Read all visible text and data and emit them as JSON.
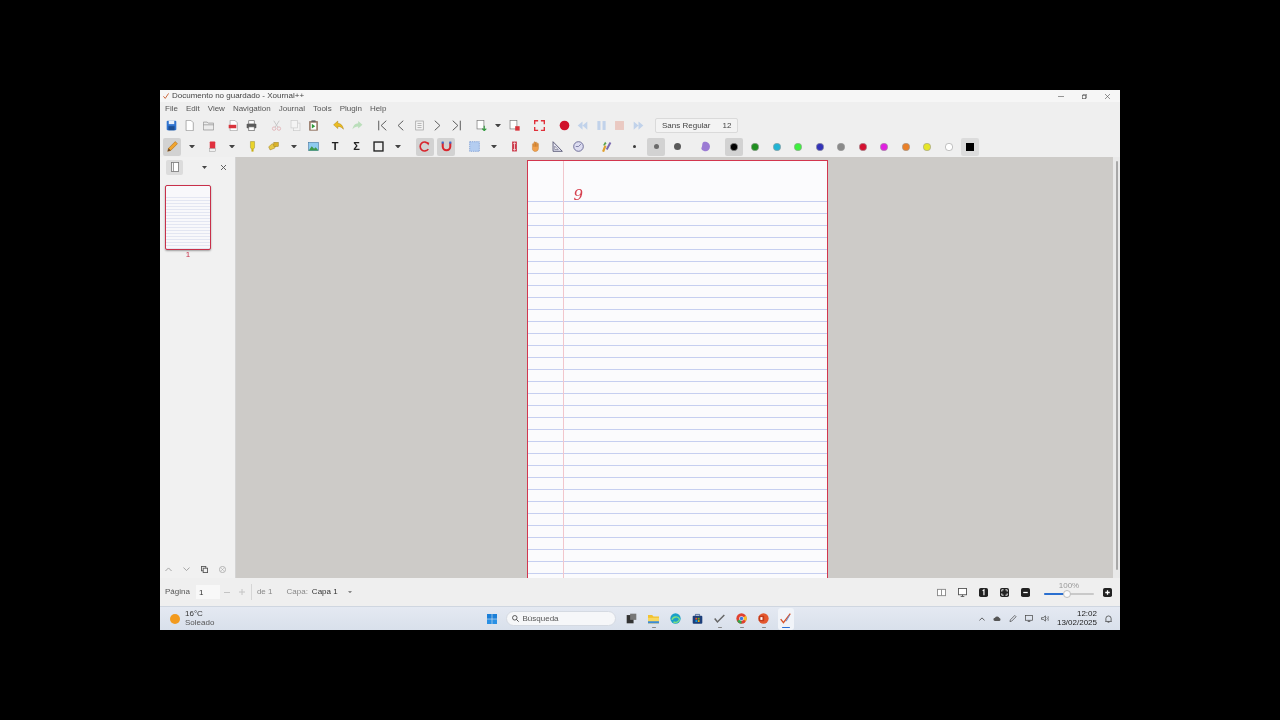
{
  "window": {
    "title": "Documento no guardado - Xournal++"
  },
  "menu": [
    "File",
    "Edit",
    "View",
    "Navigation",
    "Journal",
    "Tools",
    "Plugin",
    "Help"
  ],
  "main_toolbar": {
    "groups": [
      [
        {
          "kind": "save",
          "disabled": false,
          "menu": false
        },
        {
          "kind": "new",
          "disabled": false,
          "menu": false
        },
        {
          "kind": "open",
          "disabled": false,
          "menu": false
        }
      ],
      [
        {
          "kind": "export-pdf",
          "disabled": false,
          "menu": false
        },
        {
          "kind": "print",
          "disabled": false,
          "menu": false
        }
      ],
      [
        {
          "kind": "cut",
          "disabled": true,
          "menu": false
        },
        {
          "kind": "copy",
          "disabled": true,
          "menu": false
        },
        {
          "kind": "paste",
          "disabled": false,
          "menu": false
        }
      ],
      [
        {
          "kind": "undo",
          "disabled": false,
          "menu": false
        },
        {
          "kind": "redo",
          "disabled": true,
          "menu": false
        }
      ],
      [
        {
          "kind": "first-page",
          "disabled": false,
          "menu": false
        },
        {
          "kind": "previous-page",
          "disabled": false,
          "menu": false
        },
        {
          "kind": "go-to-page",
          "disabled": false,
          "menu": false
        },
        {
          "kind": "next-page",
          "disabled": false,
          "menu": false
        },
        {
          "kind": "last-page",
          "disabled": false,
          "menu": false
        }
      ],
      [
        {
          "kind": "insert-page",
          "disabled": false,
          "menu": true
        },
        {
          "kind": "delete-page",
          "disabled": false,
          "menu": false
        }
      ],
      [
        {
          "kind": "fullscreen",
          "disabled": false,
          "menu": false
        }
      ],
      [
        {
          "kind": "record",
          "disabled": false,
          "menu": false
        },
        {
          "kind": "rewind",
          "disabled": true,
          "menu": false
        },
        {
          "kind": "pause",
          "disabled": true,
          "menu": false
        },
        {
          "kind": "stop",
          "disabled": true,
          "menu": false
        },
        {
          "kind": "forward",
          "disabled": true,
          "menu": false
        }
      ]
    ],
    "font": {
      "name": "Sans Regular",
      "size": "12"
    }
  },
  "tool_toolbar": {
    "groups": [
      [
        {
          "kind": "pen",
          "selected": true,
          "menu": true
        },
        {
          "kind": "eraser",
          "selected": false,
          "menu": true
        },
        {
          "kind": "highlighter",
          "selected": false,
          "menu": false
        },
        {
          "kind": "region-select",
          "selected": false,
          "menu": true
        },
        {
          "kind": "image",
          "selected": false,
          "menu": false
        },
        {
          "kind": "text",
          "glyph": "T",
          "selected": false,
          "menu": false
        },
        {
          "kind": "formula",
          "glyph": "Σ",
          "selected": false,
          "menu": false
        },
        {
          "kind": "shape",
          "selected": false,
          "menu": true
        }
      ],
      [
        {
          "kind": "rotation-snap",
          "selected": true,
          "menu": false
        },
        {
          "kind": "grid-snap",
          "selected": true,
          "menu": false
        }
      ],
      [
        {
          "kind": "rect-select",
          "selected": false,
          "menu": true
        },
        {
          "kind": "vertical-space",
          "selected": false,
          "menu": false
        },
        {
          "kind": "hand",
          "selected": false,
          "menu": false
        },
        {
          "kind": "setsquare",
          "selected": false,
          "menu": false
        },
        {
          "kind": "compass",
          "selected": false,
          "menu": false
        }
      ],
      [
        {
          "kind": "toolbox",
          "selected": false,
          "menu": false
        }
      ],
      [
        {
          "kind": "size-fine",
          "selected": false,
          "menu": false
        },
        {
          "kind": "size-medium",
          "selected": true,
          "menu": false
        },
        {
          "kind": "size-thick",
          "selected": false,
          "menu": false
        }
      ],
      [
        {
          "kind": "fill",
          "selected": false,
          "menu": false
        }
      ]
    ],
    "colors": [
      {
        "color": "#000000",
        "selected": true
      },
      {
        "color": "#1f8f1f",
        "selected": false
      },
      {
        "color": "#22b4d4",
        "selected": false
      },
      {
        "color": "#3ff03f",
        "selected": false
      },
      {
        "color": "#3333b8",
        "selected": false
      },
      {
        "color": "#8a8a8a",
        "selected": false
      },
      {
        "color": "#d41030",
        "selected": false
      },
      {
        "color": "#e020e0",
        "selected": false
      },
      {
        "color": "#ea8028",
        "selected": false
      },
      {
        "color": "#e6e628",
        "selected": false
      },
      {
        "color": "#ffffff",
        "selected": false
      }
    ],
    "custom_color": {
      "color": "#000000"
    }
  },
  "sidebar": {
    "pages": [
      {
        "label": "1",
        "selected": true
      }
    ]
  },
  "page": {
    "selected": true,
    "ink": "9"
  },
  "page_nav": {
    "label": "Página",
    "value": "1",
    "total": "de 1"
  },
  "layer": {
    "label": "Capa:",
    "value": "Capa 1"
  },
  "zoom": {
    "label": "100%",
    "level": 0.46
  },
  "taskbar": {
    "weather": {
      "temperature": "16°C",
      "condition": "Soleado"
    },
    "search": {
      "placeholder": "Búsqueda"
    },
    "apps": [
      {
        "kind": "task-view",
        "running": false,
        "active": false
      },
      {
        "kind": "files",
        "running": true,
        "active": false
      },
      {
        "kind": "browser",
        "running": false,
        "active": false
      },
      {
        "kind": "store",
        "running": false,
        "active": false
      },
      {
        "kind": "check",
        "running": true,
        "active": false
      },
      {
        "kind": "web",
        "running": true,
        "active": false
      },
      {
        "kind": "slides",
        "running": true,
        "active": false
      },
      {
        "kind": "notes",
        "running": true,
        "active": true
      }
    ],
    "clock": {
      "time": "12:02",
      "date": "13/02/2025"
    }
  }
}
